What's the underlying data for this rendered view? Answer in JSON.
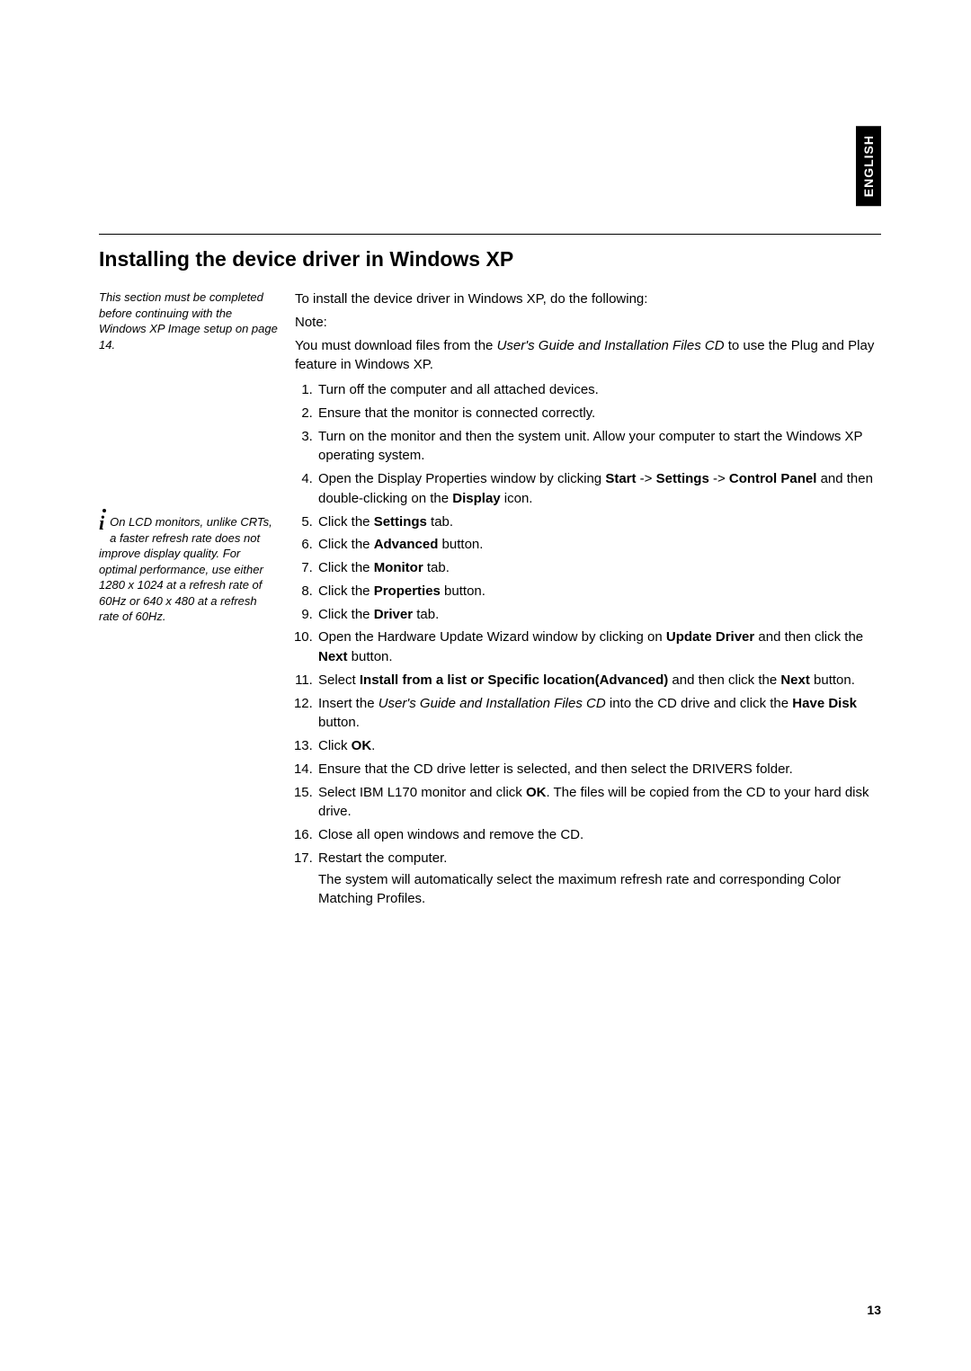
{
  "language_tab": "ENGLISH",
  "title": "Installing the device driver in Windows XP",
  "side_note_1": "This section must be completed before continuing with the Windows XP Image setup on page 14.",
  "side_note_2": "On LCD monitors, unlike CRTs, a faster refresh rate does not improve display quality. For optimal performance, use either 1280 x 1024 at a refresh rate of 60Hz or 640 x 480 at a refresh rate of 60Hz.",
  "intro_line": "To install the device driver in Windows XP, do the following:",
  "note_label": "Note:",
  "note_pre": "You must download files from the ",
  "note_ital": "User's Guide and Installation Files CD",
  "note_post": " to use the Plug and Play feature in Windows XP.",
  "steps": {
    "s1": "Turn off the computer and all attached devices.",
    "s2": "Ensure that the monitor is connected correctly.",
    "s3": "Turn on the monitor and then the system unit. Allow your computer to start the Windows XP operating system.",
    "s4_a": "Open the Display Properties window by clicking ",
    "s4_b1": "Start",
    "s4_b2": "Settings",
    "s4_b3": "Control Panel",
    "s4_mid": " and then double-clicking on the ",
    "s4_b4": "Display",
    "s4_end": " icon.",
    "s5_a": "Click the ",
    "s5_b": "Settings",
    "s5_c": " tab.",
    "s6_a": "Click the ",
    "s6_b": "Advanced",
    "s6_c": " button.",
    "s7_a": "Click the ",
    "s7_b": "Monitor",
    "s7_c": " tab.",
    "s8_a": "Click the ",
    "s8_b": "Properties",
    "s8_c": " button.",
    "s9_a": "Click the ",
    "s9_b": "Driver",
    "s9_c": " tab.",
    "s10_a": "Open the Hardware Update Wizard window by clicking on ",
    "s10_b1": "Update Driver",
    "s10_mid": " and then click the ",
    "s10_b2": "Next",
    "s10_end": " button.",
    "s11_a": "Select ",
    "s11_b": "Install from a list or Specific location(Advanced)",
    "s11_mid": " and then click the ",
    "s11_b2": "Next",
    "s11_end": " button.",
    "s12_a": "Insert the ",
    "s12_i": "User's Guide and Installation Files CD",
    "s12_mid": " into the CD drive and click the ",
    "s12_b": "Have Disk",
    "s12_end": " button.",
    "s13_a": "Click ",
    "s13_b": "OK",
    "s13_end": ".",
    "s14": "Ensure that the CD drive letter is selected, and then select the DRIVERS folder.",
    "s15_a": "Select IBM L170 monitor and click ",
    "s15_b": "OK",
    "s15_end": ". The files will be copied from the CD to your hard disk drive.",
    "s16": "Close all open windows and remove the CD.",
    "s17": "Restart the computer.",
    "s17_cont": "The system will automatically select the maximum refresh rate and corresponding Color Matching Profiles."
  },
  "arrow": " -> ",
  "page_number": "13"
}
